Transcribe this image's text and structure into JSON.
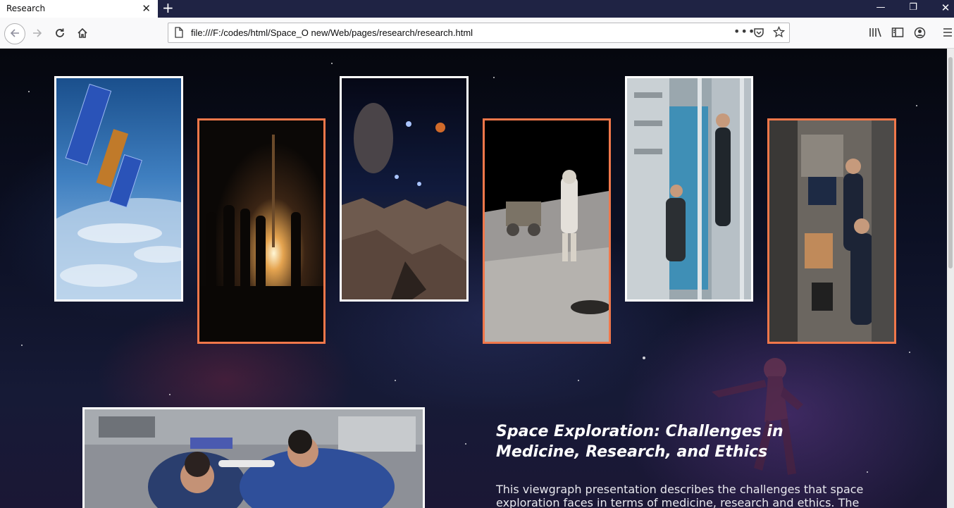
{
  "browser": {
    "tab_title": "Research",
    "url": "file:///F:/codes/html/Space_O new/Web/pages/research/research.html"
  },
  "gallery": [
    {
      "name": "satellite-over-earth",
      "border": "#ffffff"
    },
    {
      "name": "rocket-launch-silhouettes",
      "border": "#f0774a"
    },
    {
      "name": "alien-planet-landscape",
      "border": "#ffffff"
    },
    {
      "name": "astronaut-on-moon",
      "border": "#f0774a"
    },
    {
      "name": "astronaut-in-station-module",
      "border": "#ffffff"
    },
    {
      "name": "astronauts-in-station-lab",
      "border": "#f0774a"
    }
  ],
  "article": {
    "title": "Space Exploration: Challenges in Medicine, Research, and Ethics",
    "body": "This viewgraph presentation describes the challenges that space exploration faces in terms of medicine, research and ethics. The"
  },
  "colors": {
    "accent_border": "#f0774a",
    "frame_border": "#ffffff",
    "tabbar": "#1f2344"
  }
}
